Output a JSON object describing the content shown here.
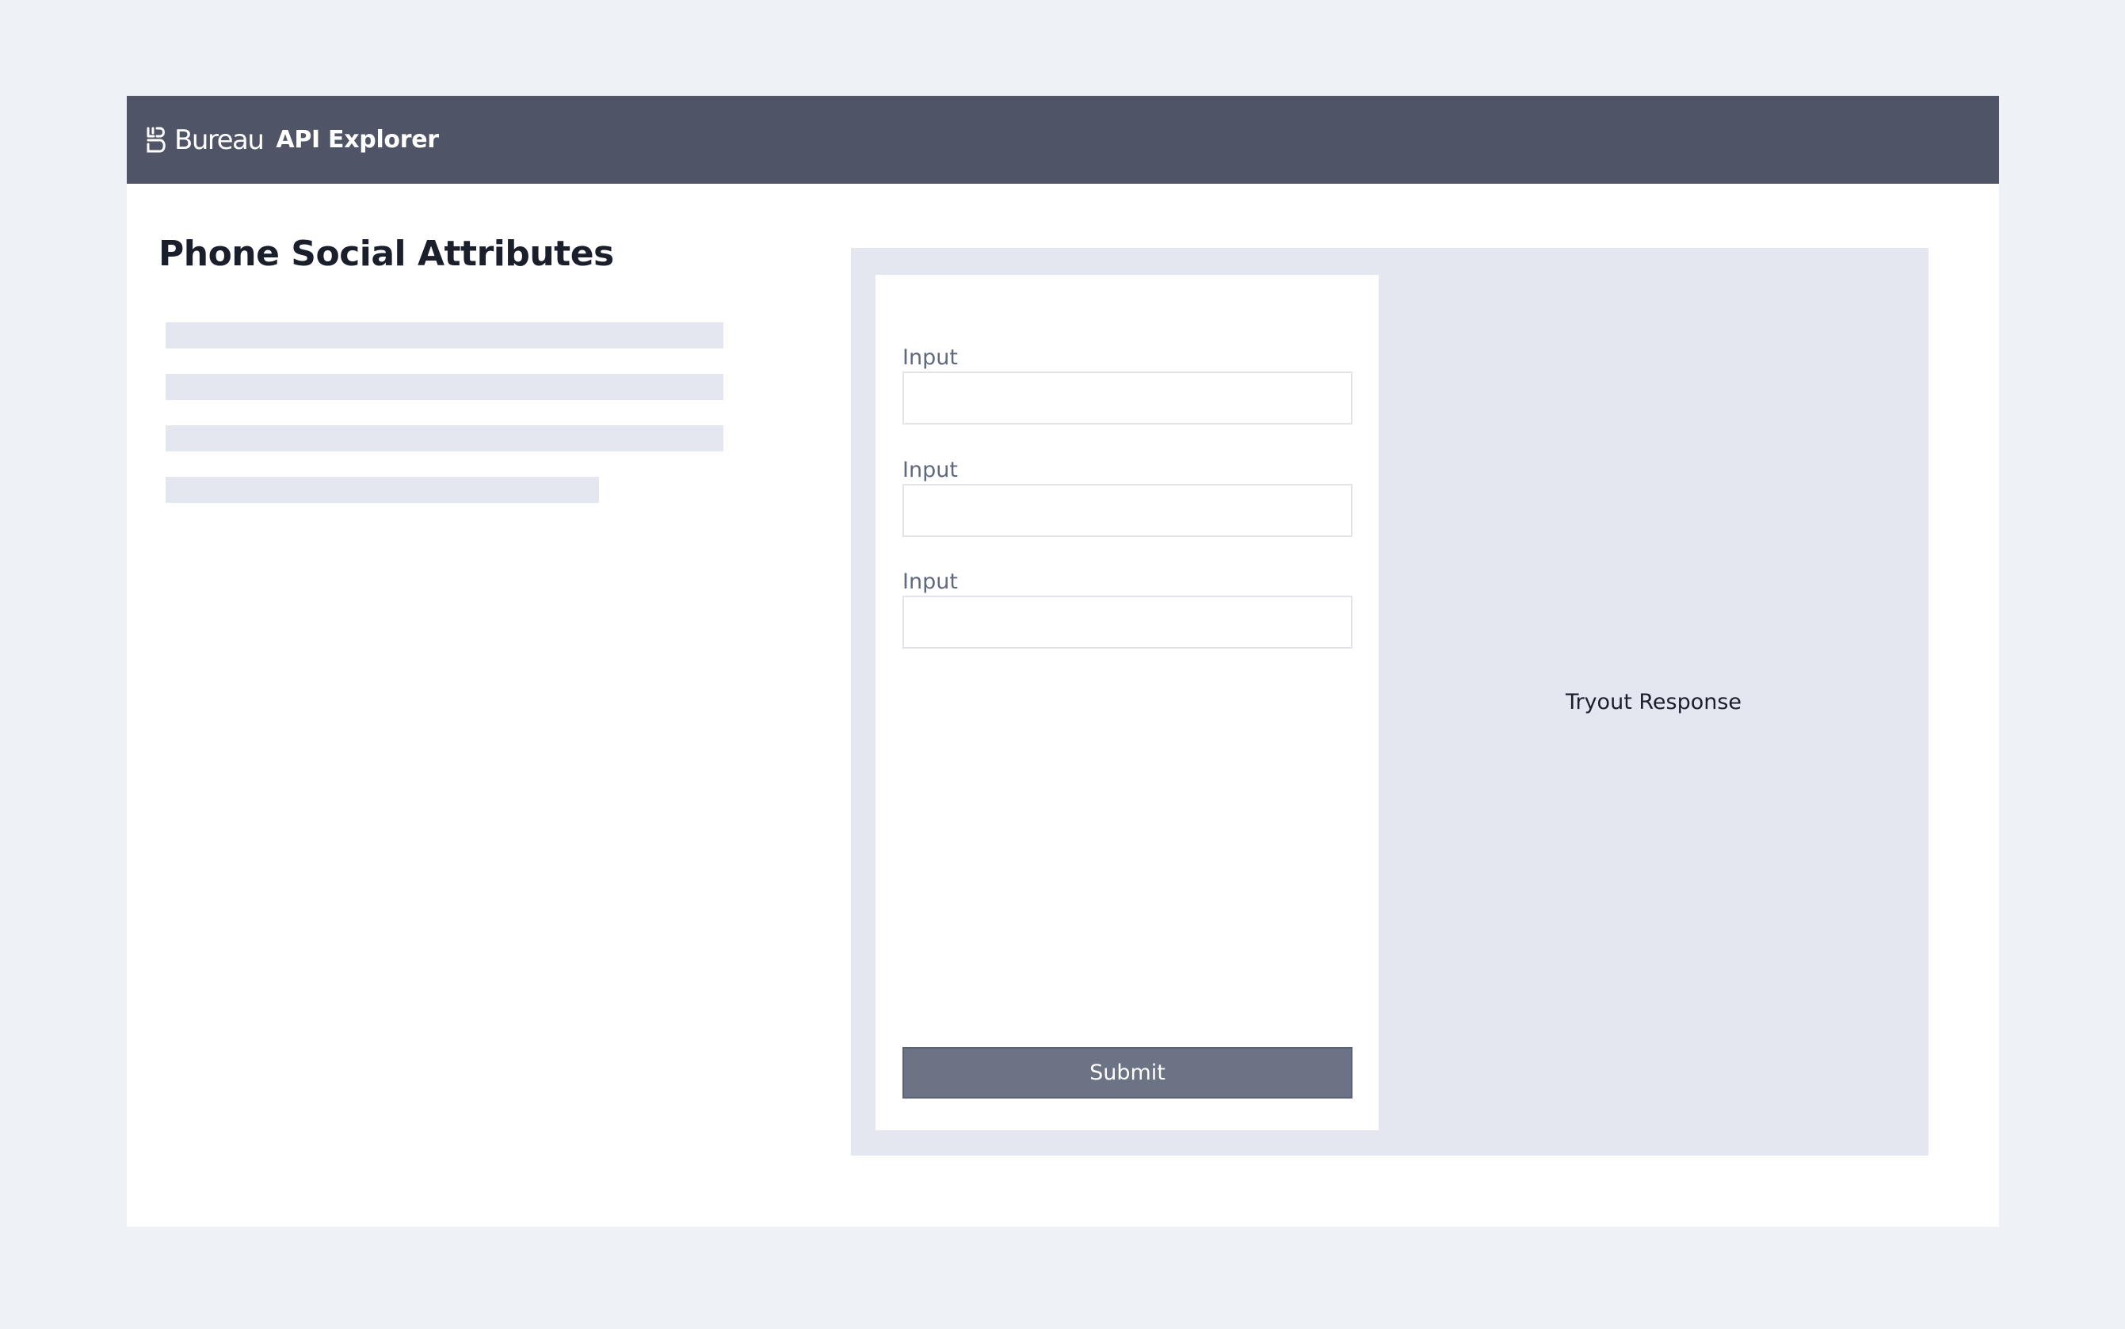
{
  "header": {
    "brand": "Bureau",
    "product": "API Explorer"
  },
  "page": {
    "title": "Phone Social Attributes"
  },
  "form": {
    "fields": [
      {
        "label": "Input",
        "value": ""
      },
      {
        "label": "Input",
        "value": ""
      },
      {
        "label": "Input",
        "value": ""
      }
    ],
    "submit_label": "Submit"
  },
  "response": {
    "placeholder": "Tryout Response"
  },
  "colors": {
    "header_bg": "#4f5567",
    "page_bg": "#eef1f5",
    "panel_bg": "#e4e7ef",
    "button_bg": "#6b7385"
  }
}
